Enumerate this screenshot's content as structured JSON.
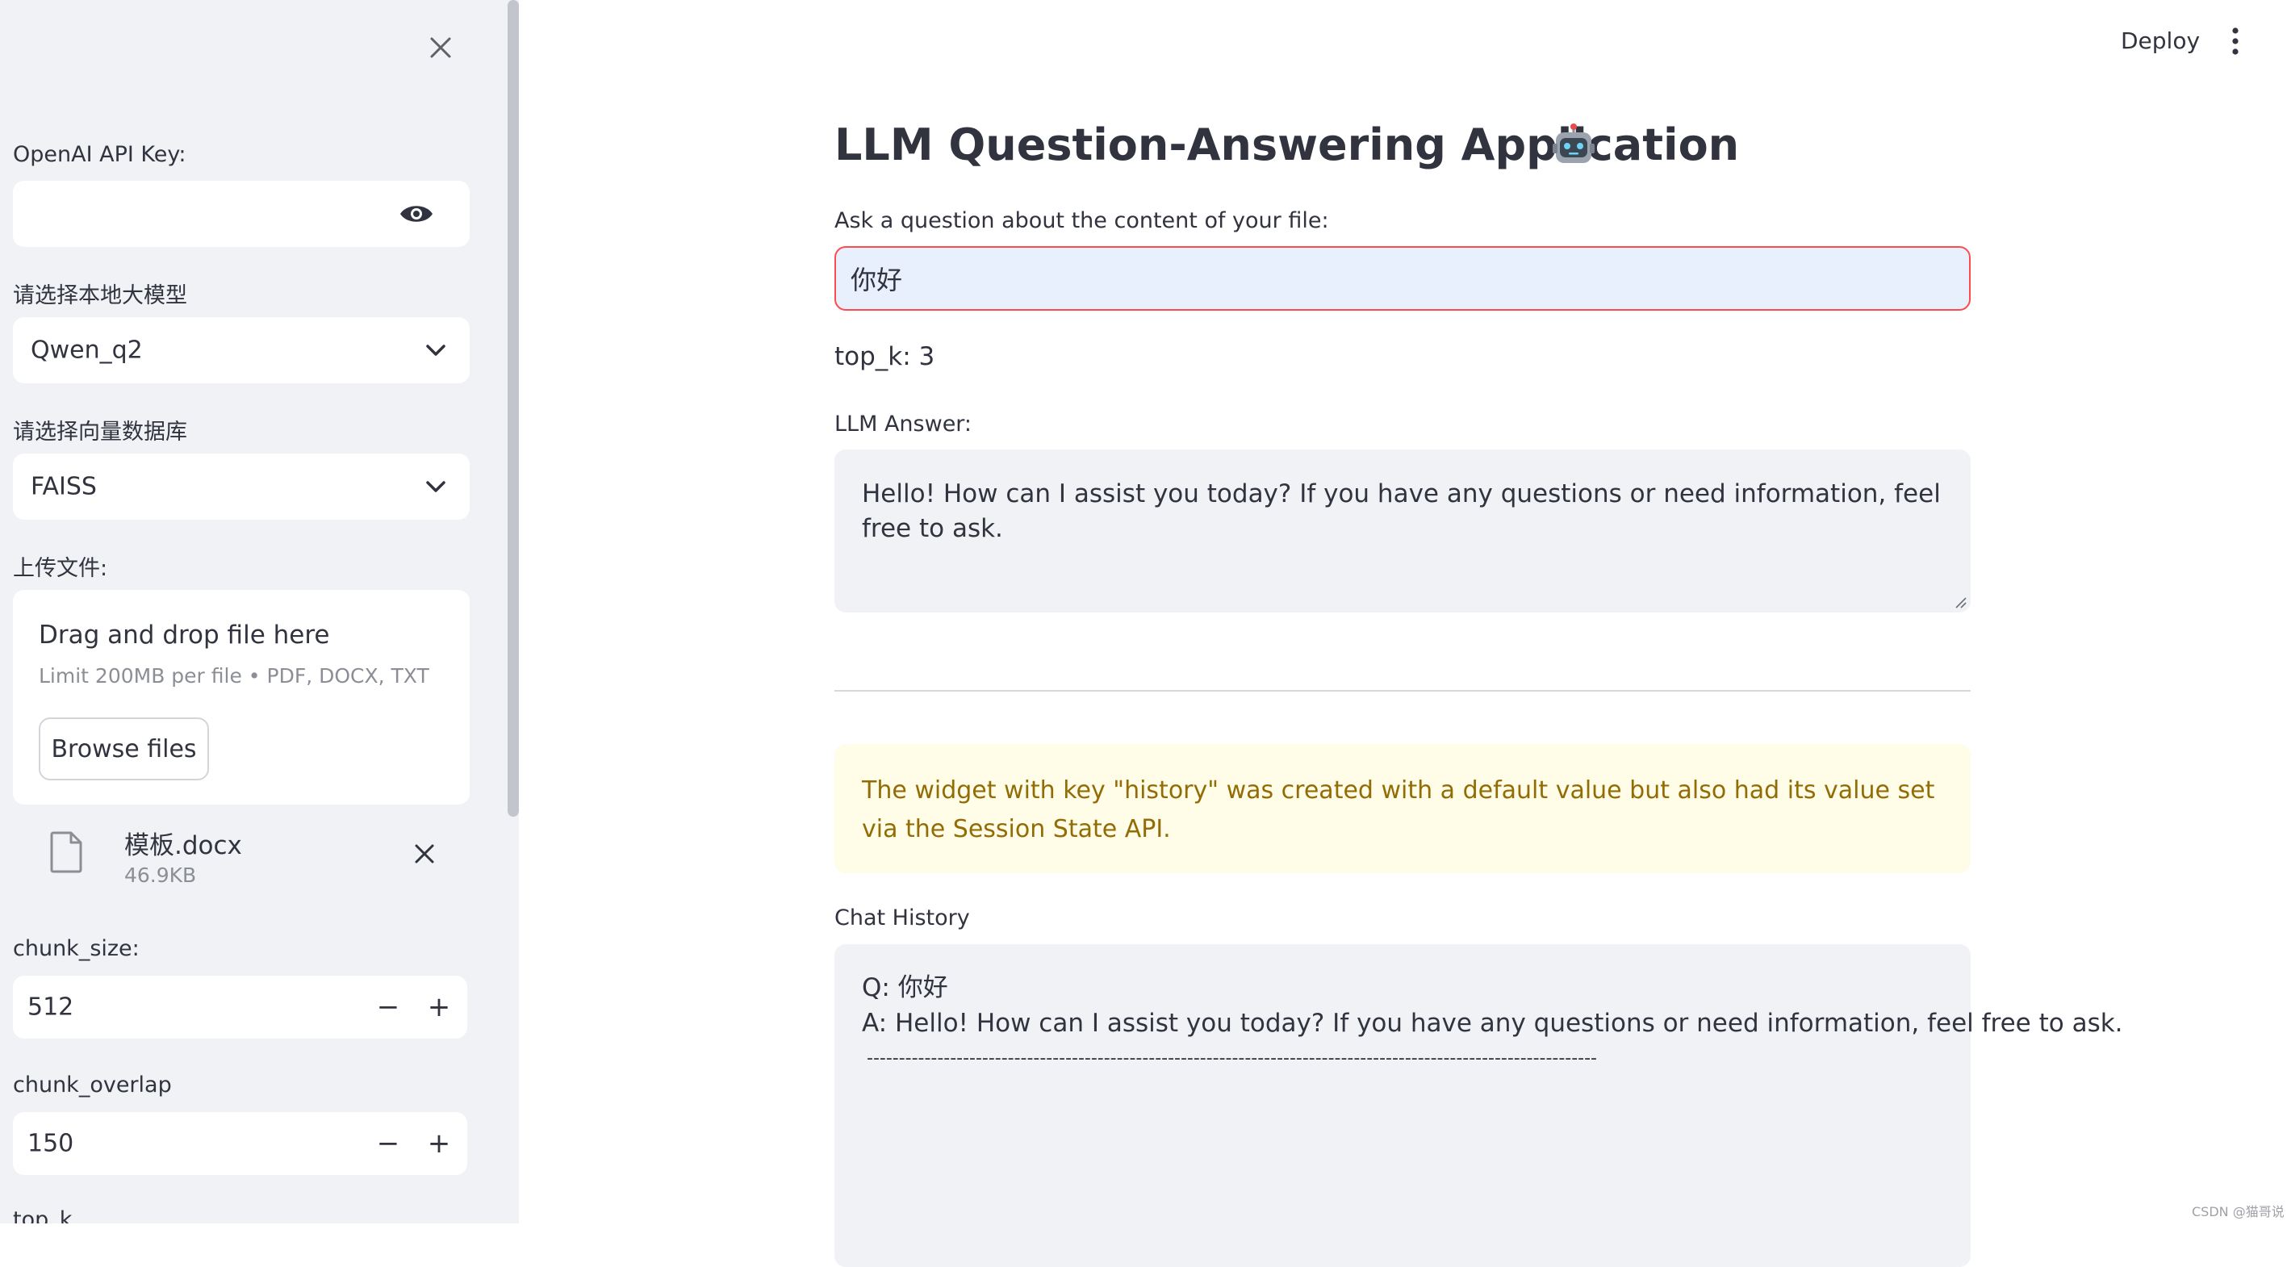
{
  "sidebar": {
    "api_key_label": "OpenAI API Key:",
    "api_key_value": "",
    "model_label": "请选择本地大模型",
    "model_value": "Qwen_q2",
    "vectordb_label": "请选择向量数据库",
    "vectordb_value": "FAISS",
    "upload_label": "上传文件:",
    "dropzone": {
      "title": "Drag and drop file here",
      "limit": "Limit 200MB per file • PDF, DOCX, TXT",
      "browse_label": "Browse files"
    },
    "uploaded_file": {
      "name": "模板.docx",
      "size": "46.9KB"
    },
    "chunk_size": {
      "label": "chunk_size:",
      "value": "512",
      "minus": "−",
      "plus": "+"
    },
    "chunk_overlap": {
      "label": "chunk_overlap",
      "value": "150",
      "minus": "−",
      "plus": "+"
    },
    "top_k_label": "top_k"
  },
  "header": {
    "deploy_label": "Deploy"
  },
  "main": {
    "title": "LLM Question-Answering Application",
    "title_icon": "robot-icon",
    "question_label": "Ask a question about the content of your file:",
    "question_value": "你好",
    "topk_text": "top_k: 3",
    "answer_label": "LLM Answer:",
    "answer_text": "Hello! How can I assist you today? If you have any questions or need information, feel free to ask.",
    "warning_text": "The widget with key \"history\" was created with a default value but also had its value set via the Session State API.",
    "history_label": "Chat History",
    "history": {
      "q": "Q: 你好",
      "a": "A: Hello! How can I assist you today? If you have any questions or need information, feel free to ask.",
      "separator": "------------------------------------------------------------------------------------------------------------------"
    }
  },
  "watermark": "CSDN @猫哥说",
  "colors": {
    "sidebar_bg": "#F0F2F6",
    "primary": "#FF4B4B",
    "text": "#31333F",
    "warning_bg": "#FFFCE7",
    "warning_text": "#926C05",
    "input_focus_bg": "#E8F0FE"
  }
}
